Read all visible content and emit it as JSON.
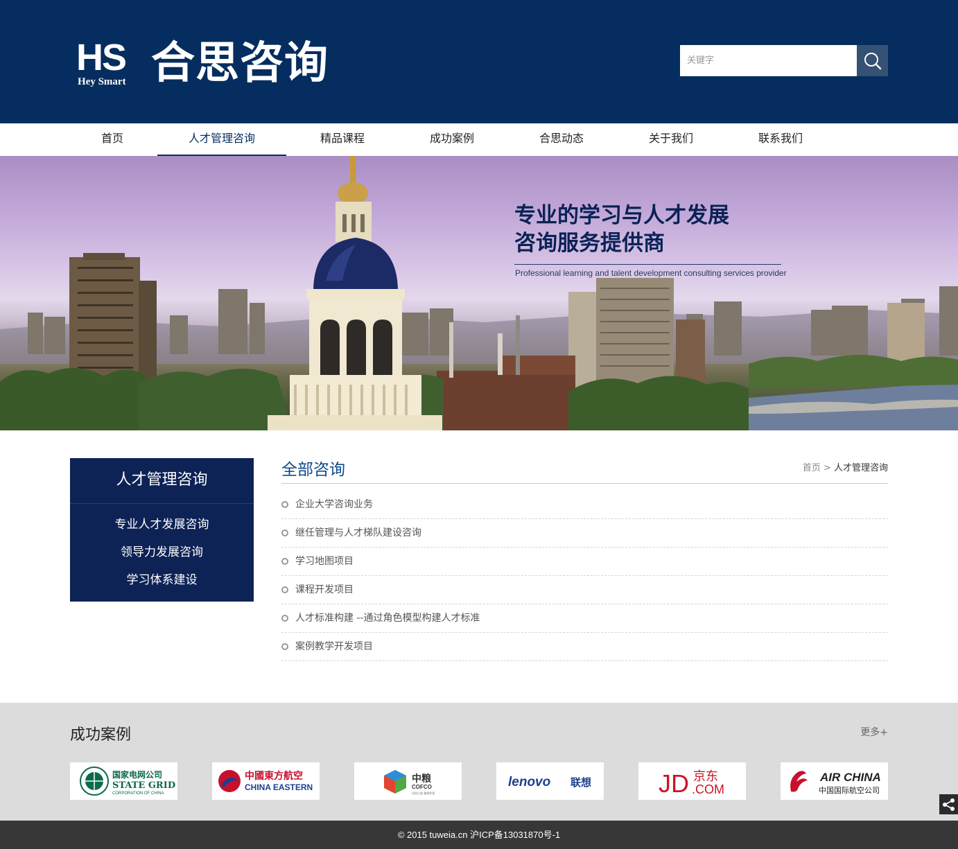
{
  "header": {
    "logo_mark": "HS",
    "logo_en": "Hey Smart",
    "logo_cn": "合思咨询",
    "search_placeholder": "关键字",
    "search_icon": "search-icon"
  },
  "nav": {
    "items": [
      {
        "label": "首页"
      },
      {
        "label": "人才管理咨询",
        "active": true
      },
      {
        "label": "精品课程"
      },
      {
        "label": "成功案例"
      },
      {
        "label": "合思动态"
      },
      {
        "label": "关于我们"
      },
      {
        "label": "联系我们"
      }
    ]
  },
  "banner": {
    "title_line1": "专业的学习与人才发展",
    "title_line2": "咨询服务提供商",
    "subtitle": "Professional learning and talent development consulting services provider"
  },
  "sidebar": {
    "title": "人才管理咨询",
    "items": [
      {
        "label": "专业人才发展咨询"
      },
      {
        "label": "领导力发展咨询"
      },
      {
        "label": "学习体系建设"
      }
    ]
  },
  "content": {
    "title": "全部咨询",
    "breadcrumb": {
      "home": "首页",
      "separator": ">",
      "current": "人才管理咨询"
    },
    "items": [
      {
        "label": "企业大学咨询业务"
      },
      {
        "label": "继任管理与人才梯队建设咨询"
      },
      {
        "label": "学习地图项目"
      },
      {
        "label": "课程开发项目"
      },
      {
        "label": "人才标准构建 --通过角色模型构建人才标准"
      },
      {
        "label": "案例教学开发项目"
      }
    ]
  },
  "cases": {
    "title": "成功案例",
    "more": "更多+",
    "partners": [
      {
        "name": "State Grid",
        "cn": "国家电网公司",
        "en": "STATE GRID",
        "en2": "CORPORATION OF CHINA",
        "color": "#0b6a4b"
      },
      {
        "name": "China Eastern",
        "cn": "中國東方航空",
        "en": "CHINA EASTERN",
        "color": "#c8102e",
        "color2": "#1b3f8f"
      },
      {
        "name": "COFCO",
        "cn": "中粮",
        "en": "COFCO",
        "sub": "自然之源 重塑你我",
        "color": "#333"
      },
      {
        "name": "Lenovo",
        "en": "lenovo",
        "cn": "联想",
        "color": "#1d3f8f"
      },
      {
        "name": "JD",
        "en": "JD",
        "cn": "京东",
        "com": ".COM",
        "color": "#c91623"
      },
      {
        "name": "Air China",
        "en": "AIR CHINA",
        "cn": "中国国际航空公司",
        "color": "#c8102e"
      }
    ]
  },
  "share": {
    "icon": "share-icon"
  },
  "footer": {
    "copyright": "© 2015 tuweia.cn 沪ICP备13031870号-1"
  },
  "colors": {
    "header_bg": "#062d5f",
    "sidebar_bg": "#0d2255",
    "accent": "#0d4a8a",
    "cases_bg": "#dcdcdc",
    "footer_bg": "#373737"
  }
}
